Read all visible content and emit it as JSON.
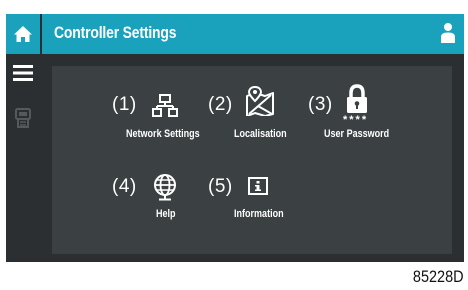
{
  "header": {
    "title": "Controller Settings"
  },
  "icons": {
    "home": "home-icon",
    "user": "user-icon",
    "menu": "menu-icon",
    "controller": "controller-icon"
  },
  "colors": {
    "accent": "#1aa2bd",
    "screen_bg": "#2b2f31",
    "panel_bg": "#3b4143",
    "text": "#ffffff"
  },
  "items": [
    {
      "number": "(1)",
      "label": "Network Settings",
      "icon": "network-icon"
    },
    {
      "number": "(2)",
      "label": "Localisation",
      "icon": "map-icon"
    },
    {
      "number": "(3)",
      "label": "User Password",
      "icon": "lock-icon"
    },
    {
      "number": "(4)",
      "label": "Help",
      "icon": "globe-icon"
    },
    {
      "number": "(5)",
      "label": "Information",
      "icon": "info-icon"
    }
  ],
  "password_mask": "****",
  "footer": {
    "code": "85228D"
  }
}
